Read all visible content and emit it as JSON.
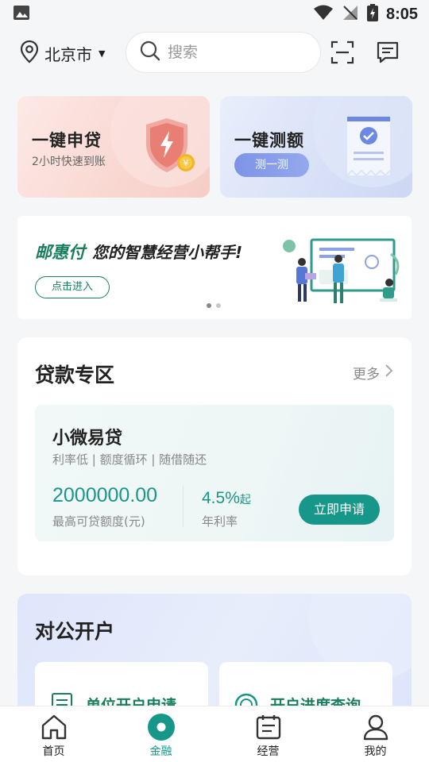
{
  "status_bar": {
    "time": "8:05"
  },
  "header": {
    "city": "北京市",
    "search_placeholder": "搜索"
  },
  "quick_cards": {
    "loan": {
      "title": "一键申贷",
      "subtitle": "2小时快速到账"
    },
    "quota": {
      "title": "一键测额",
      "button": "测一测"
    }
  },
  "banner": {
    "brand": "邮惠付",
    "slogan": "您的智慧经营小帮手!",
    "button": "点击进入",
    "page_count": 2,
    "active_page": 1
  },
  "loan_section": {
    "title": "贷款专区",
    "more": "更多",
    "product": {
      "name": "小微易贷",
      "tags": "利率低 | 额度循环 | 随借随还",
      "amount": "2000000.00",
      "amount_label": "最高可贷额度(元)",
      "rate": "4.5%",
      "rate_suffix": "起",
      "rate_label": "年利率",
      "apply": "立即申请"
    }
  },
  "corp_section": {
    "title": "对公开户",
    "cards": [
      {
        "label": "单位开户申请"
      },
      {
        "label": "开户进度查询"
      }
    ]
  },
  "bottom_nav": {
    "items": [
      {
        "label": "首页",
        "icon": "home-icon"
      },
      {
        "label": "金融",
        "icon": "finance-icon"
      },
      {
        "label": "经营",
        "icon": "business-icon"
      },
      {
        "label": "我的",
        "icon": "profile-icon"
      }
    ],
    "active_index": 1
  },
  "colors": {
    "accent": "#17978a",
    "brand_green": "#1a7e5e",
    "loan_card": "#f9d7d1",
    "quota_card": "#d7e0f7"
  }
}
